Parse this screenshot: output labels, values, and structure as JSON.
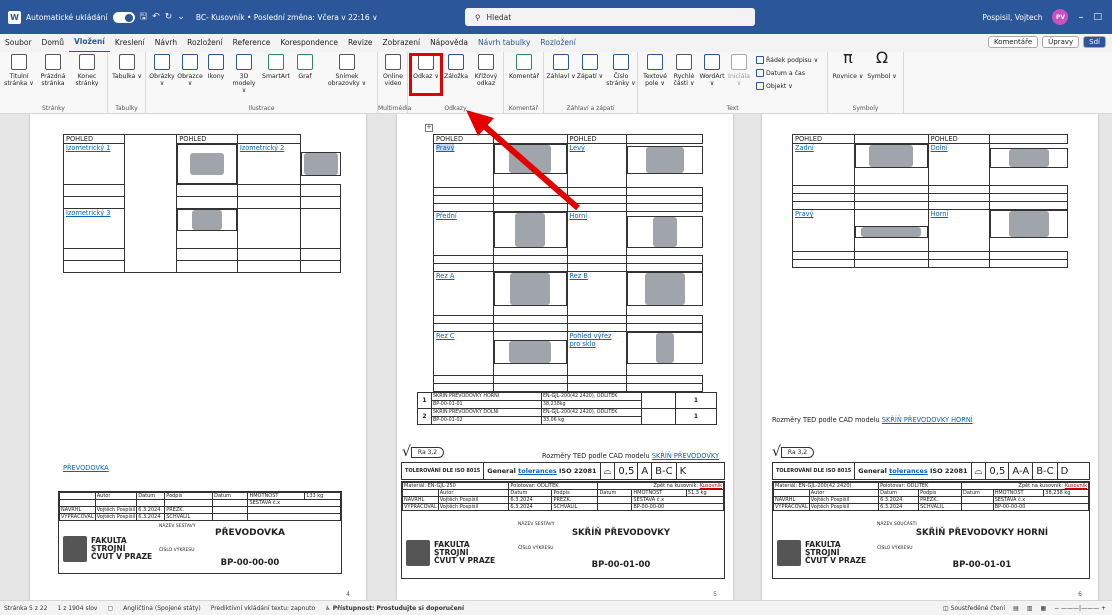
{
  "titlebar": {
    "app_icon": "word-icon",
    "autosave": "Automatické ukládání",
    "toggle": "Zap",
    "doc_title": "BC- Kusovník • Poslední změna: Včera v 22:16 ∨",
    "search_placeholder": "Hledat",
    "user": "Pospisil, Vojtech",
    "initials": "PV"
  },
  "menubar": {
    "tabs": [
      "Soubor",
      "Domů",
      "Vložení",
      "Kreslení",
      "Návrh",
      "Rozložení",
      "Reference",
      "Korespondence",
      "Revize",
      "Zobrazení",
      "Nápověda",
      "Návrh tabulky",
      "Rozložení"
    ],
    "active": "Vložení",
    "comments": "Komentáře",
    "edits": "Úpravy",
    "share": "Sdí"
  },
  "ribbon": {
    "groups": [
      "Stránky",
      "Tabulky",
      "Ilustrace",
      "Multimédia",
      "Odkazy",
      "Komentář",
      "Záhlaví a zápatí",
      "Text",
      "Symboly"
    ],
    "buttons": {
      "titulni": "Titulní stránka ∨",
      "prazdna": "Prázdná stránka",
      "konec": "Konec stránky",
      "tabulka": "Tabulka ∨",
      "obrazky": "Obrázky ∨",
      "obrazce": "Obrazce ∨",
      "ikony": "Ikony",
      "modely": "3D modely ∨",
      "smartart": "SmartArt",
      "graf": "Graf",
      "snimek": "Snímek obrazovky ∨",
      "video": "Online video",
      "odkaz": "Odkaz ∨",
      "zalozka": "Záložka",
      "krizovy": "Křížový odkaz",
      "komentar": "Komentář",
      "zahlavi": "Záhlaví ∨",
      "zapati": "Zápatí ∨",
      "cislo": "Číslo stránky ∨",
      "textove": "Textové pole ∨",
      "rychle": "Rychlé části ∨",
      "wordart": "WordArt ∨",
      "iniciala": "Iniciála ∨",
      "radek": "Řádek podpisu ∨",
      "datum": "Datum a čas",
      "objekt": "Objekt ∨",
      "rovnice": "Rovnice ∨",
      "symbol": "Symbol ∨"
    }
  },
  "page4": {
    "views": [
      {
        "hdr": "POHLED",
        "link": "Izometrický 1"
      },
      {
        "hdr": "POHLED",
        "link": "Izometrický 2"
      },
      {
        "link": "Izometrický 3"
      }
    ],
    "assembly_link": "PŘEVODOVKA",
    "title_block": {
      "autor": "Autor",
      "datum": "Datum",
      "podpis": "Podpis",
      "hmotnost": "HMOTNOST",
      "mass": "133 kg",
      "navrhl": "NAVRHL",
      "vypracoval": "VYPRACOVAL",
      "name1": "Vojtěch Pospíšil",
      "date1": "6.3.2024",
      "prezk": "PŘEZK.",
      "schvalil": "SCHVÁLIL",
      "sestava": "SESTAVA č.x",
      "nazev_label": "NÁZEV SESTAVY",
      "nazev": "PŘEVODOVKA",
      "cislo_label": "ČÍSLO VÝKRESU",
      "cislo": "BP-00-00-00",
      "fak1": "FAKULTA",
      "fak2": "STROJNÍ",
      "fak3": "ČVUT V PRAZE"
    },
    "num": "4"
  },
  "page5": {
    "views": [
      {
        "hdr": "POHLED",
        "link": "Pravý"
      },
      {
        "hdr": "POHLED",
        "link": "Levý"
      },
      {
        "link": "Přední"
      },
      {
        "link": "Horní"
      },
      {
        "link": "Řez A"
      },
      {
        "link": "Řez B"
      },
      {
        "link": "Řez C"
      },
      {
        "link": "Pohled výřez pro sklo"
      }
    ],
    "bom": [
      {
        "pos": "1",
        "name": "SKŘÍŇ PŘEVODOVKY HORNÍ",
        "num": "BP-00-01-01",
        "mat": "EN-GJL-200(42 2420), ODLITEK",
        "mass": "38,238kg",
        "qty": "1"
      },
      {
        "pos": "2",
        "name": "SKŘÍŇ PŘEVODOVKY DOLNÍ",
        "num": "BP-00-01-02",
        "mat": "EN-GJL-200(42 2420), ODLITEK",
        "mass": "33,06 kg",
        "qty": "1"
      }
    ],
    "ted": "Rozměry TED podle CAD modelu",
    "ted_link": "SKŘÍŇ PŘEVODOVKY",
    "ra": "Ra 3,2",
    "tol1": "TOLEROVÁNÍ DLE ISO 8015",
    "tol2": "General",
    "tol2b": "tolerances",
    "tol2c": "ISO 22081",
    "tol_val": "0,5",
    "tol_a": "A",
    "tol_bc": "B-C",
    "tol_k": "K",
    "title_block": {
      "material": "Materiál: EN-GJL-250",
      "polotovar": "Polotovar: ODLITEK",
      "zpet": "Zpět na kusovník:",
      "zpet_link": "Kusovník",
      "hmotnost": "51,3 kg",
      "name": "SKŘÍŇ PŘEVODOVKY",
      "cislo": "BP-00-01-00",
      "nazev_label": "NÁZEV SESTAVY"
    },
    "num": "5"
  },
  "page6": {
    "views": [
      {
        "hdr": "POHLED",
        "link": "Zadní"
      },
      {
        "hdr": "POHLED",
        "link": "Dolní"
      },
      {
        "link": "Pravý"
      },
      {
        "link": "Horní"
      }
    ],
    "ted": "Rozměry TED podle CAD modelu",
    "ted_link": "SKŘÍŇ PŘEVODOVKY HORNÍ",
    "ra": "Ra 3,2",
    "tol_a": "A-A",
    "tol_bc": "B-C",
    "tol_k": "D",
    "tol_val": "0,5",
    "title_block": {
      "material": "Materiál: EN-GJL-200(42 2420)",
      "polotovar": "Polotovar: ODLITEK",
      "hmotnost": "38,238 kg",
      "nazev_label": "NÁZEV SOUČÁSTI",
      "name": "SKŘÍŇ PŘEVODOVKY HORNÍ",
      "cislo": "BP-00-01-01",
      "sestava_num": "BP-00-00-00"
    },
    "num": "6"
  },
  "status": {
    "page": "Stránka 5 z 22",
    "words": "1 z 1904 slov",
    "lang": "Angličtina (Spojené státy)",
    "predict": "Prediktivní vkládání textu: zapnuto",
    "access": "Přístupnost: Prostudujte si doporučení",
    "focus": "Soustředěné čtení"
  }
}
